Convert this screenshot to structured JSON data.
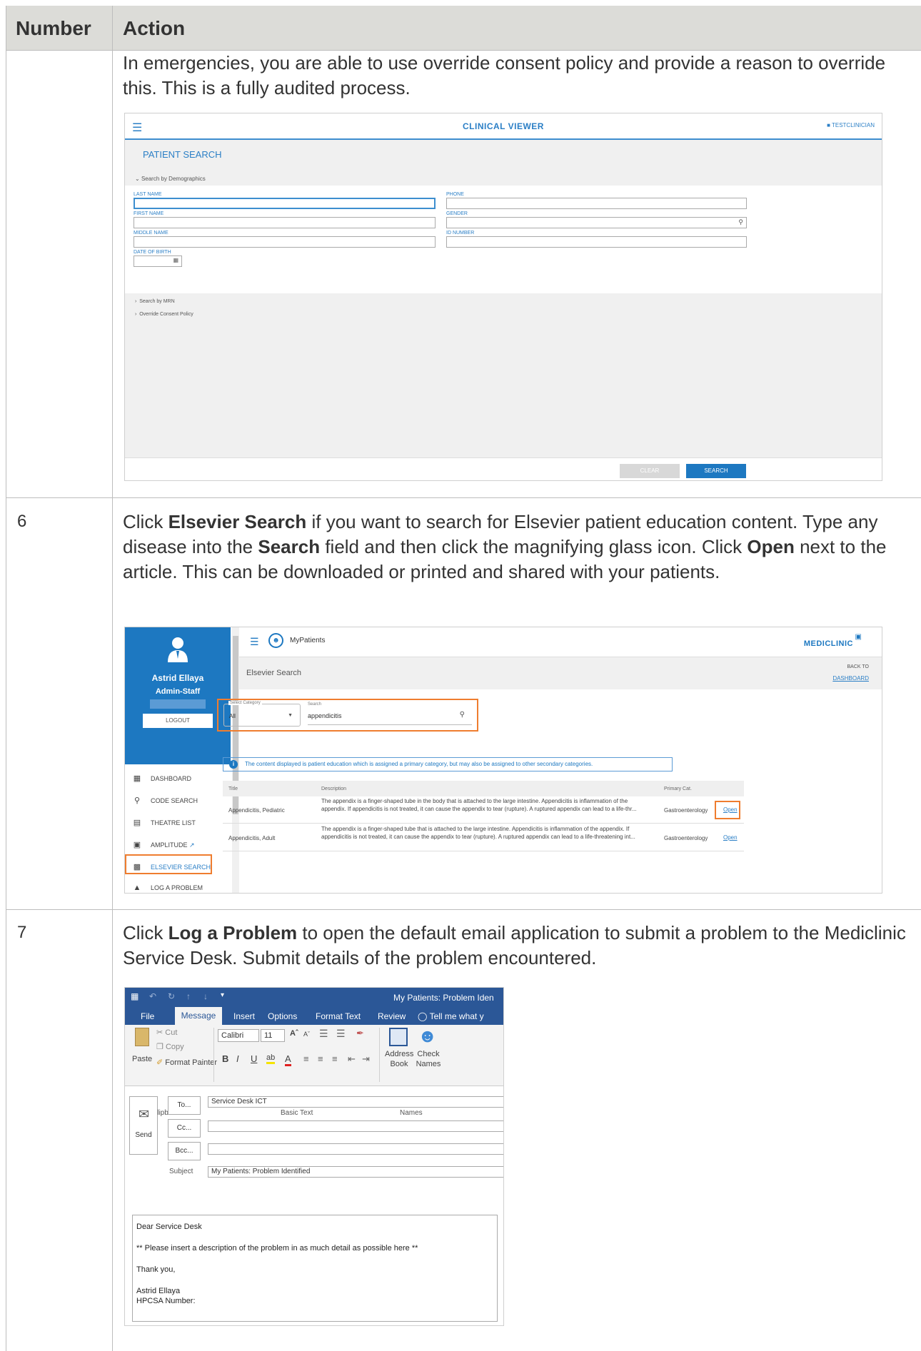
{
  "header": {
    "col_number": "Number",
    "col_action": "Action"
  },
  "row5": {
    "text": "In emergencies, you are able to use override consent policy and provide a reason to override this. This is a fully audited process.",
    "screen": {
      "title": "CLINICAL VIEWER",
      "user": "TESTCLINICIAN",
      "patient_search": "PATIENT SEARCH",
      "search_by_demographics": "Search by Demographics",
      "labels": {
        "last_name": "LAST NAME",
        "first_name": "FIRST NAME",
        "middle_name": "MIDDLE NAME",
        "date_of_birth": "DATE OF BIRTH",
        "phone": "PHONE",
        "gender": "GENDER",
        "id_number": "ID NUMBER"
      },
      "search_by_mrn": "Search by MRN",
      "override_consent": "Override Consent Policy",
      "clear": "CLEAR",
      "search": "SEARCH"
    }
  },
  "row6": {
    "number": "6",
    "text_html_parts": [
      "Click ",
      "Elsevier Search",
      " if you want to search for Elsevier patient education content. Type any disease into the ",
      "Search",
      " field and then click the magnifying glass icon. Click ",
      "Open",
      " next to the article. This can be downloaded or printed and shared with your patients."
    ],
    "screen": {
      "user_name": "Astrid Ellaya",
      "user_role": "Admin-Staff",
      "logout": "LOGOUT",
      "menu": [
        "DASHBOARD",
        "CODE SEARCH",
        "THEATRE LIST",
        "AMPLITUDE",
        "ELSEVIER SEARCH",
        "LOG A PROBLEM"
      ],
      "app_title": "MyPatients",
      "brand": "MEDICLINIC",
      "page_title": "Elsevier Search",
      "back_to": "BACK TO",
      "dashboard_link": "DASHBOARD",
      "select_category_label": "Select Category",
      "select_category_value": "All",
      "search_label": "Search",
      "search_value": "appendicitis",
      "info": "The content displayed is patient education which is assigned a primary category, but may also be assigned to other secondary categories.",
      "columns": [
        "Title",
        "Description",
        "Primary Cat."
      ],
      "rows": [
        {
          "title": "Appendicitis, Pediatric",
          "description": "The appendix is a finger-shaped tube in the body that is attached to the large intestine. Appendicitis is inflammation of the appendix. If appendicitis is not treated, it can cause the appendix to tear (rupture). A ruptured appendix can lead to a life-thr...",
          "category": "Gastroenterology",
          "action": "Open"
        },
        {
          "title": "Appendicitis, Adult",
          "description": "The appendix is a finger-shaped tube that is attached to the large intestine. Appendicitis is inflammation of the appendix. If appendicitis is not treated, it can cause the appendix to tear (rupture). A ruptured appendix can lead to a life-threatening int...",
          "category": "Gastroenterology",
          "action": "Open"
        }
      ]
    }
  },
  "row7": {
    "number": "7",
    "text_parts": [
      "Click ",
      "Log a Problem",
      " to open the default email application to submit a problem to the Mediclinic Service Desk. Submit details of the problem encountered."
    ],
    "screen": {
      "window_title": "My Patients: Problem Iden",
      "tabs": [
        "File",
        "Message",
        "Insert",
        "Options",
        "Format Text",
        "Review",
        "Tell me what y"
      ],
      "cut": "Cut",
      "copy": "Copy",
      "paste": "Paste",
      "format_painter": "Format Painter",
      "clipboard": "Clipboard",
      "font": "Calibri",
      "font_size": "11",
      "basic_text": "Basic Text",
      "address_book": "Address Book",
      "check_names": "Check Names",
      "names": "Names",
      "send": "Send",
      "to": "To...",
      "cc": "Cc...",
      "bcc": "Bcc...",
      "to_value": "Service Desk ICT",
      "subject_label": "Subject",
      "subject_value": "My Patients: Problem Identified",
      "body": [
        "Dear Service Desk",
        "** Please insert a description of the problem in as much detail as possible here **",
        "Thank you,",
        "Astrid Ellaya",
        "HPCSA Number:"
      ]
    }
  }
}
